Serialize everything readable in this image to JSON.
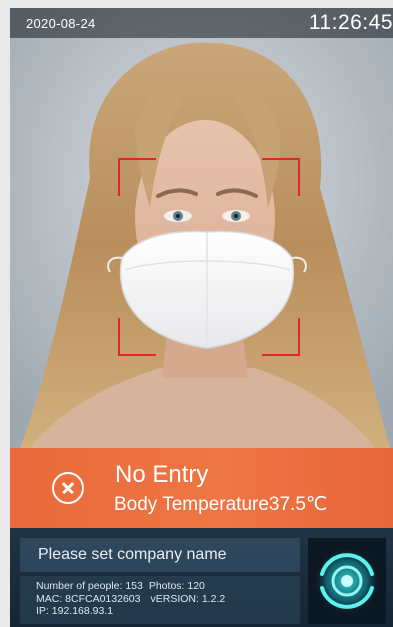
{
  "status": {
    "date": "2020-08-24",
    "time": "11:26:45"
  },
  "alert": {
    "title": "No Entry",
    "temperature_label": "Body Temperature",
    "temperature_value": "37.5",
    "temperature_unit": "℃",
    "icon": "close-circle-icon",
    "color": "#ec6f3f"
  },
  "company": {
    "name": "Please set company name"
  },
  "device": {
    "people_label": "Number of people: ",
    "people_count": "153",
    "photos_label": "Photos: ",
    "photos_count": "120",
    "mac_label": "MAC: ",
    "mac": "8CFCA0132603",
    "version_label": "vERSION: ",
    "version": "1.2.2",
    "ip_label": "IP: ",
    "ip": "192.168.93.1"
  },
  "colors": {
    "frame": "#e8242b",
    "panel": "#1f3446",
    "accent": "#3fe3e0"
  }
}
